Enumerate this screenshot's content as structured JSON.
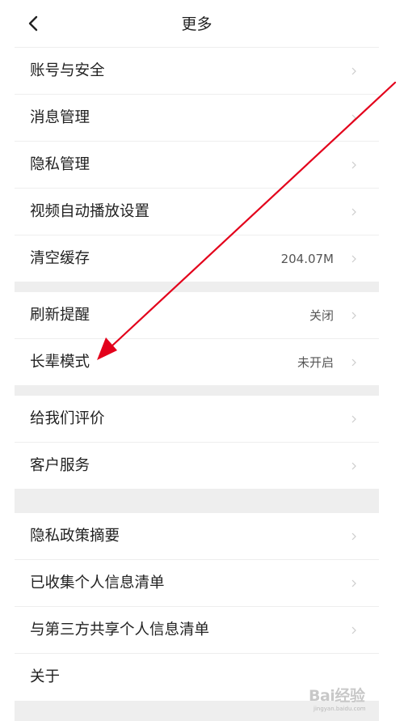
{
  "header": {
    "title": "更多",
    "back_icon": "chevron-left-icon"
  },
  "groups": [
    {
      "items": [
        {
          "label": "账号与安全",
          "value": ""
        },
        {
          "label": "消息管理",
          "value": ""
        },
        {
          "label": "隐私管理",
          "value": ""
        },
        {
          "label": "视频自动播放设置",
          "value": ""
        },
        {
          "label": "清空缓存",
          "value": "204.07M"
        }
      ]
    },
    {
      "items": [
        {
          "label": "刷新提醒",
          "value": "关闭"
        },
        {
          "label": "长辈模式",
          "value": "未开启"
        }
      ]
    },
    {
      "items": [
        {
          "label": "给我们评价",
          "value": ""
        },
        {
          "label": "客户服务",
          "value": ""
        }
      ]
    },
    {
      "items": [
        {
          "label": "隐私政策摘要",
          "value": ""
        },
        {
          "label": "已收集个人信息清单",
          "value": ""
        },
        {
          "label": "与第三方共享个人信息清单",
          "value": ""
        },
        {
          "label": "关于",
          "value": ""
        }
      ]
    }
  ],
  "annotation": {
    "type": "arrow",
    "color": "#e3001b",
    "points_to": "长辈模式"
  },
  "watermark": {
    "logo": "Bai经验",
    "url": "jingyan.baidu.com"
  },
  "colors": {
    "background": "#ffffff",
    "separator": "#eeeeee",
    "section_gap": "#eeeeee",
    "text": "#222222",
    "value_text": "#555555",
    "arrow_icon": "#cccccc"
  }
}
